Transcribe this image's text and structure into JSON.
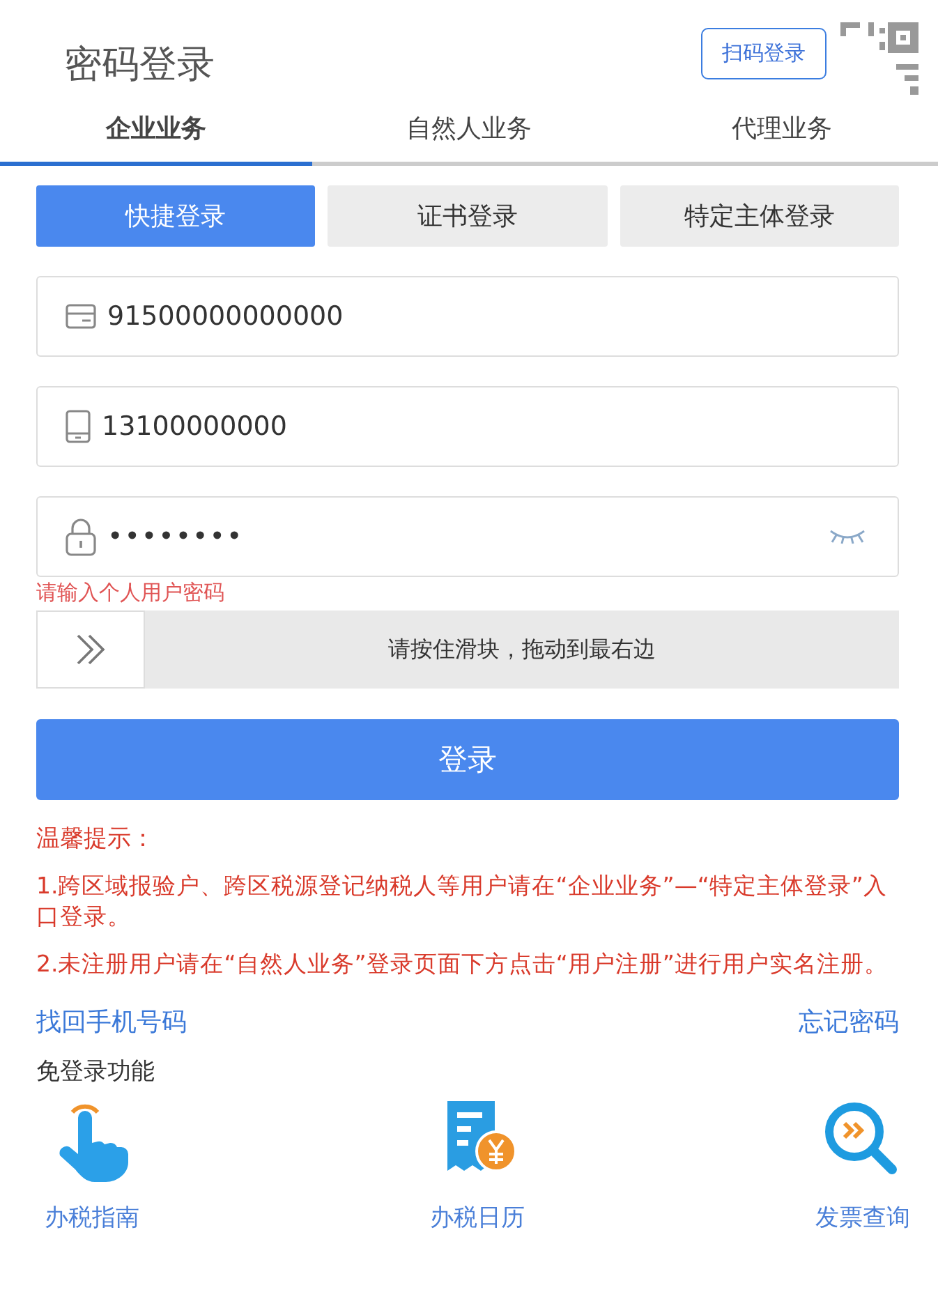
{
  "title": "密码登录",
  "qr_login": {
    "label": "扫码登录"
  },
  "tabs": [
    {
      "label": "企业业务",
      "selected": true
    },
    {
      "label": "自然人业务",
      "selected": false
    },
    {
      "label": "代理业务",
      "selected": false
    }
  ],
  "login_types": [
    {
      "label": "快捷登录",
      "selected": true
    },
    {
      "label": "证书登录",
      "selected": false
    },
    {
      "label": "特定主体登录",
      "selected": false
    }
  ],
  "fields": [
    {
      "kind": "card",
      "value": "91500000000000"
    },
    {
      "kind": "phone",
      "value": "13100000000"
    },
    {
      "kind": "password",
      "value": "••••••••",
      "error": "请输入个人用户密码"
    }
  ],
  "slider": {
    "label": "请按住滑块，拖动到最右边",
    "level": 0
  },
  "login_button": "登录",
  "tips_title": "温馨提示：",
  "tips": [
    "1.跨区域报验户、跨区税源登记纳税人等用户请在“企业业务”—“特定主体登录”入口登录。",
    "2.未注册用户请在“自然人业务”登录页面下方点击“用户注册”进行用户实名注册。"
  ],
  "links": [
    "找回手机号码",
    "忘记密码"
  ],
  "quick_title": "免登录功能",
  "quick": [
    {
      "kind": "guide",
      "label": "办税指南"
    },
    {
      "kind": "calendar",
      "label": "办税日历"
    },
    {
      "kind": "invoice",
      "label": "发票查询"
    }
  ]
}
